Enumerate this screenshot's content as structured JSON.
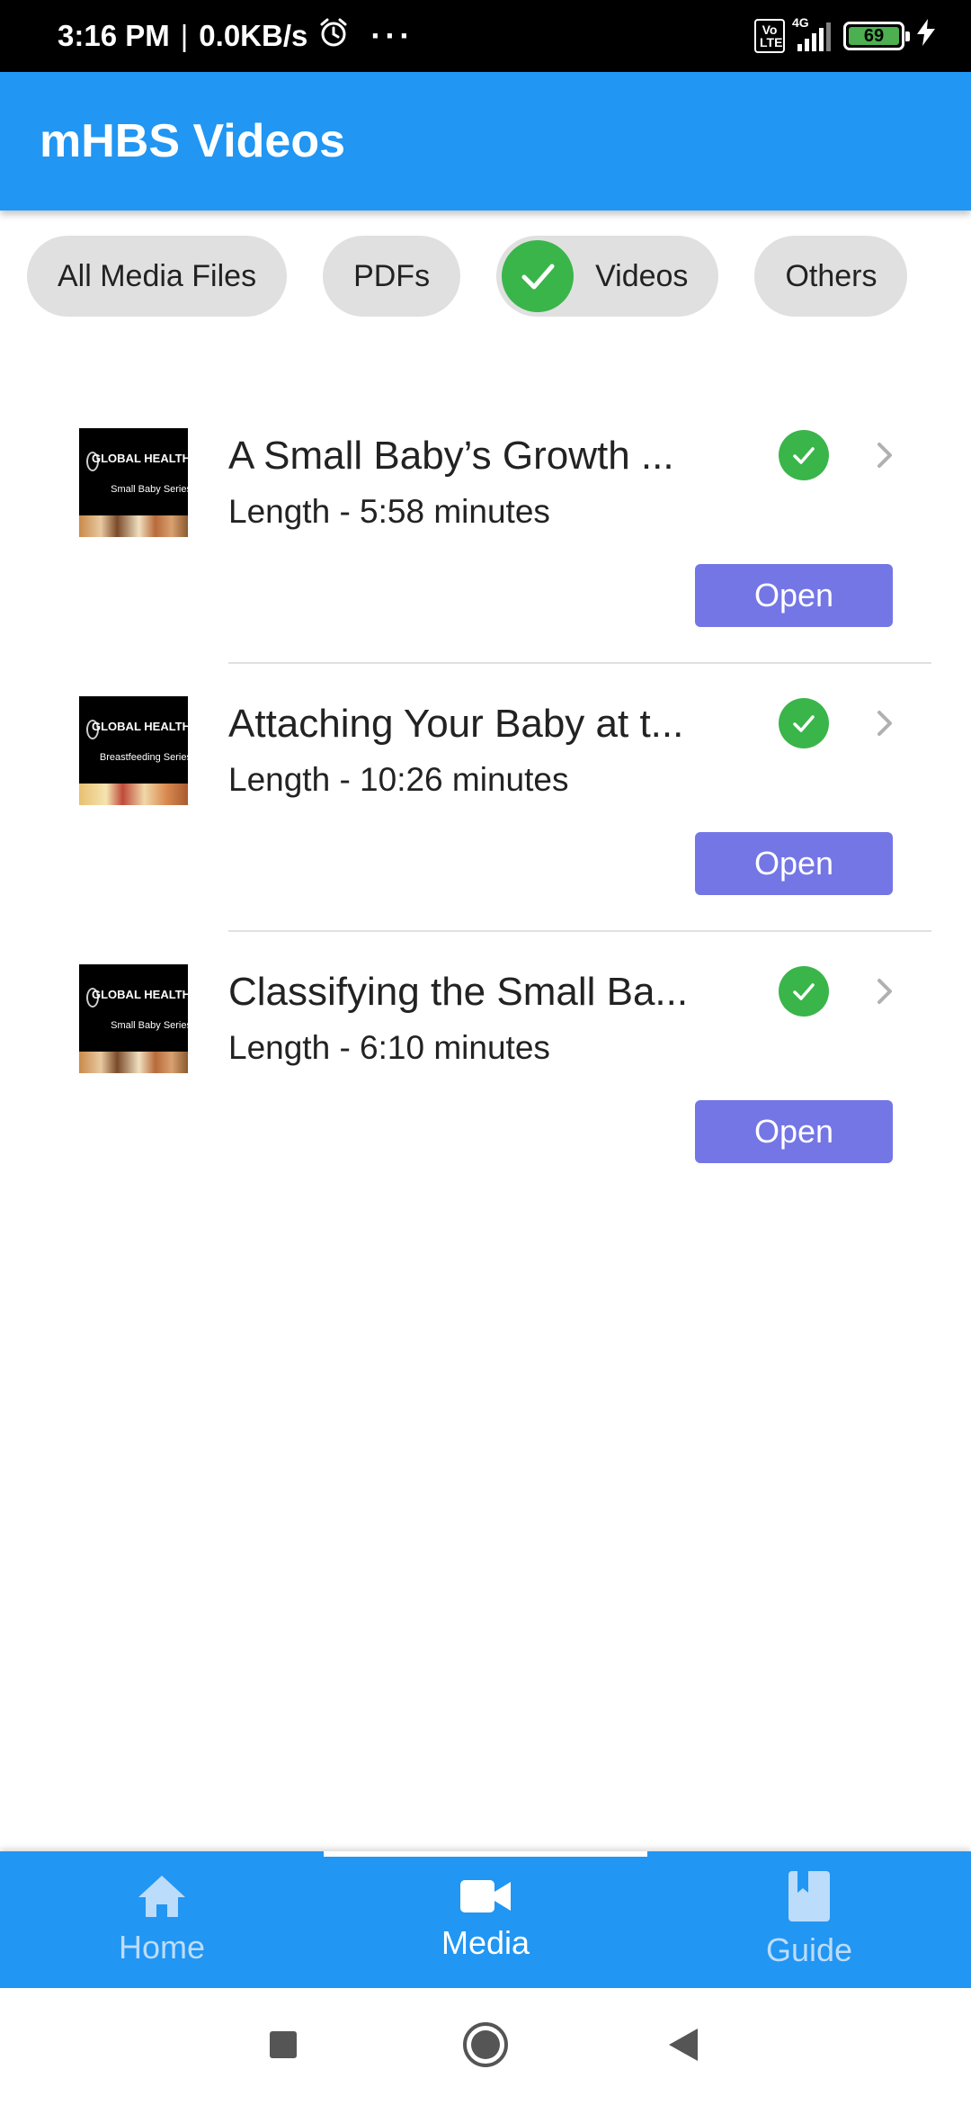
{
  "status_bar": {
    "time": "3:16 PM",
    "speed": "0.0KB/s",
    "more": "···",
    "volte": "Vo LTE",
    "network": "4G",
    "battery": "69"
  },
  "app_bar": {
    "title": "mHBS Videos"
  },
  "filters": {
    "chips": [
      {
        "label": "All Media Files",
        "selected": false
      },
      {
        "label": "PDFs",
        "selected": false
      },
      {
        "label": "Videos",
        "selected": true
      },
      {
        "label": "Others",
        "selected": false
      }
    ]
  },
  "videos": [
    {
      "title": "A Small Baby’s Growth ...",
      "length": "Length - 5:58 minutes",
      "thumb_line1": "GLOBAL HEALTH MEDIA",
      "thumb_line2": "Small Baby Series",
      "open_label": "Open",
      "downloaded": true
    },
    {
      "title": "Attaching Your Baby at t...",
      "length": "Length - 10:26 minutes",
      "thumb_line1": "GLOBAL HEALTH MEDIA",
      "thumb_line2": "Breastfeeding Series",
      "open_label": "Open",
      "downloaded": true
    },
    {
      "title": "Classifying the Small Ba...",
      "length": "Length - 6:10 minutes",
      "thumb_line1": "GLOBAL HEALTH MEDIA",
      "thumb_line2": "Small Baby Series",
      "open_label": "Open",
      "downloaded": true
    }
  ],
  "bottom_nav": {
    "items": [
      {
        "label": "Home",
        "icon": "home-icon",
        "active": false
      },
      {
        "label": "Media",
        "icon": "video-camera-icon",
        "active": true
      },
      {
        "label": "Guide",
        "icon": "book-icon",
        "active": false
      }
    ]
  },
  "colors": {
    "primary": "#2196f3",
    "open_button": "#7476e6",
    "check_green": "#3ab54a",
    "chip_bg": "#e0e0e0"
  }
}
